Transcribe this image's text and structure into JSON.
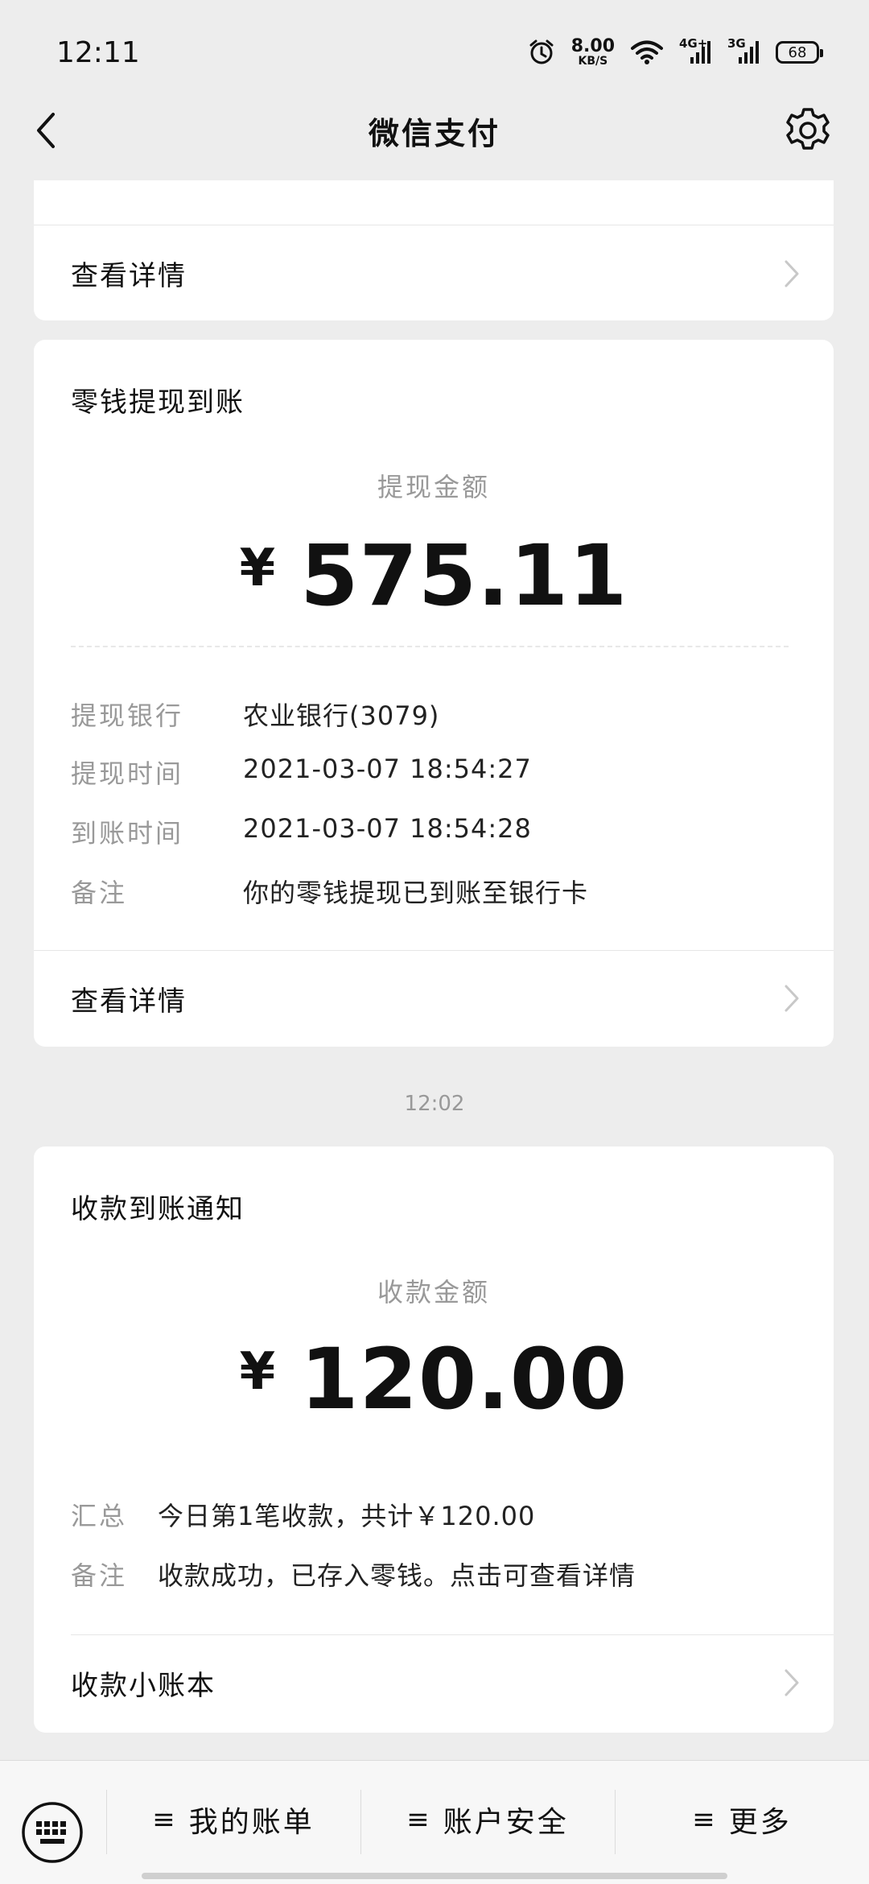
{
  "status_bar": {
    "time": "12:11",
    "net_speed_value": "8.00",
    "net_speed_unit": "KB/S",
    "signal_1": "4G+",
    "signal_2": "3G",
    "battery": "68"
  },
  "header": {
    "title": "微信支付"
  },
  "cards": {
    "top_stub": {
      "link_label": "查看详情"
    },
    "withdraw": {
      "title": "零钱提现到账",
      "amount_label": "提现金额",
      "currency": "¥",
      "amount": "575.11",
      "rows": [
        {
          "key": "提现银行",
          "value": "农业银行(3079)"
        },
        {
          "key": "提现时间",
          "value": "2021-03-07 18:54:27"
        },
        {
          "key": "到账时间",
          "value": "2021-03-07 18:54:28"
        },
        {
          "key": "备注",
          "value": "你的零钱提现已到账至银行卡"
        }
      ],
      "link_label": "查看详情"
    },
    "time_separator": "12:02",
    "receipt": {
      "title": "收款到账通知",
      "amount_label": "收款金额",
      "currency": "¥",
      "amount": "120.00",
      "rows": [
        {
          "key": "汇总",
          "value": "今日第1笔收款，共计￥120.00"
        },
        {
          "key": "备注",
          "value": "收款成功，已存入零钱。点击可查看详情"
        }
      ],
      "link_label": "收款小账本"
    }
  },
  "bottom_bar": {
    "menu_glyph": "≡",
    "items": [
      {
        "label": "我的账单"
      },
      {
        "label": "账户安全"
      },
      {
        "label": "更多"
      }
    ]
  },
  "icons": {
    "back": "chevron-left-icon",
    "settings": "gear-icon",
    "keyboard": "keyboard-icon",
    "chevron": "chevron-right-icon"
  }
}
